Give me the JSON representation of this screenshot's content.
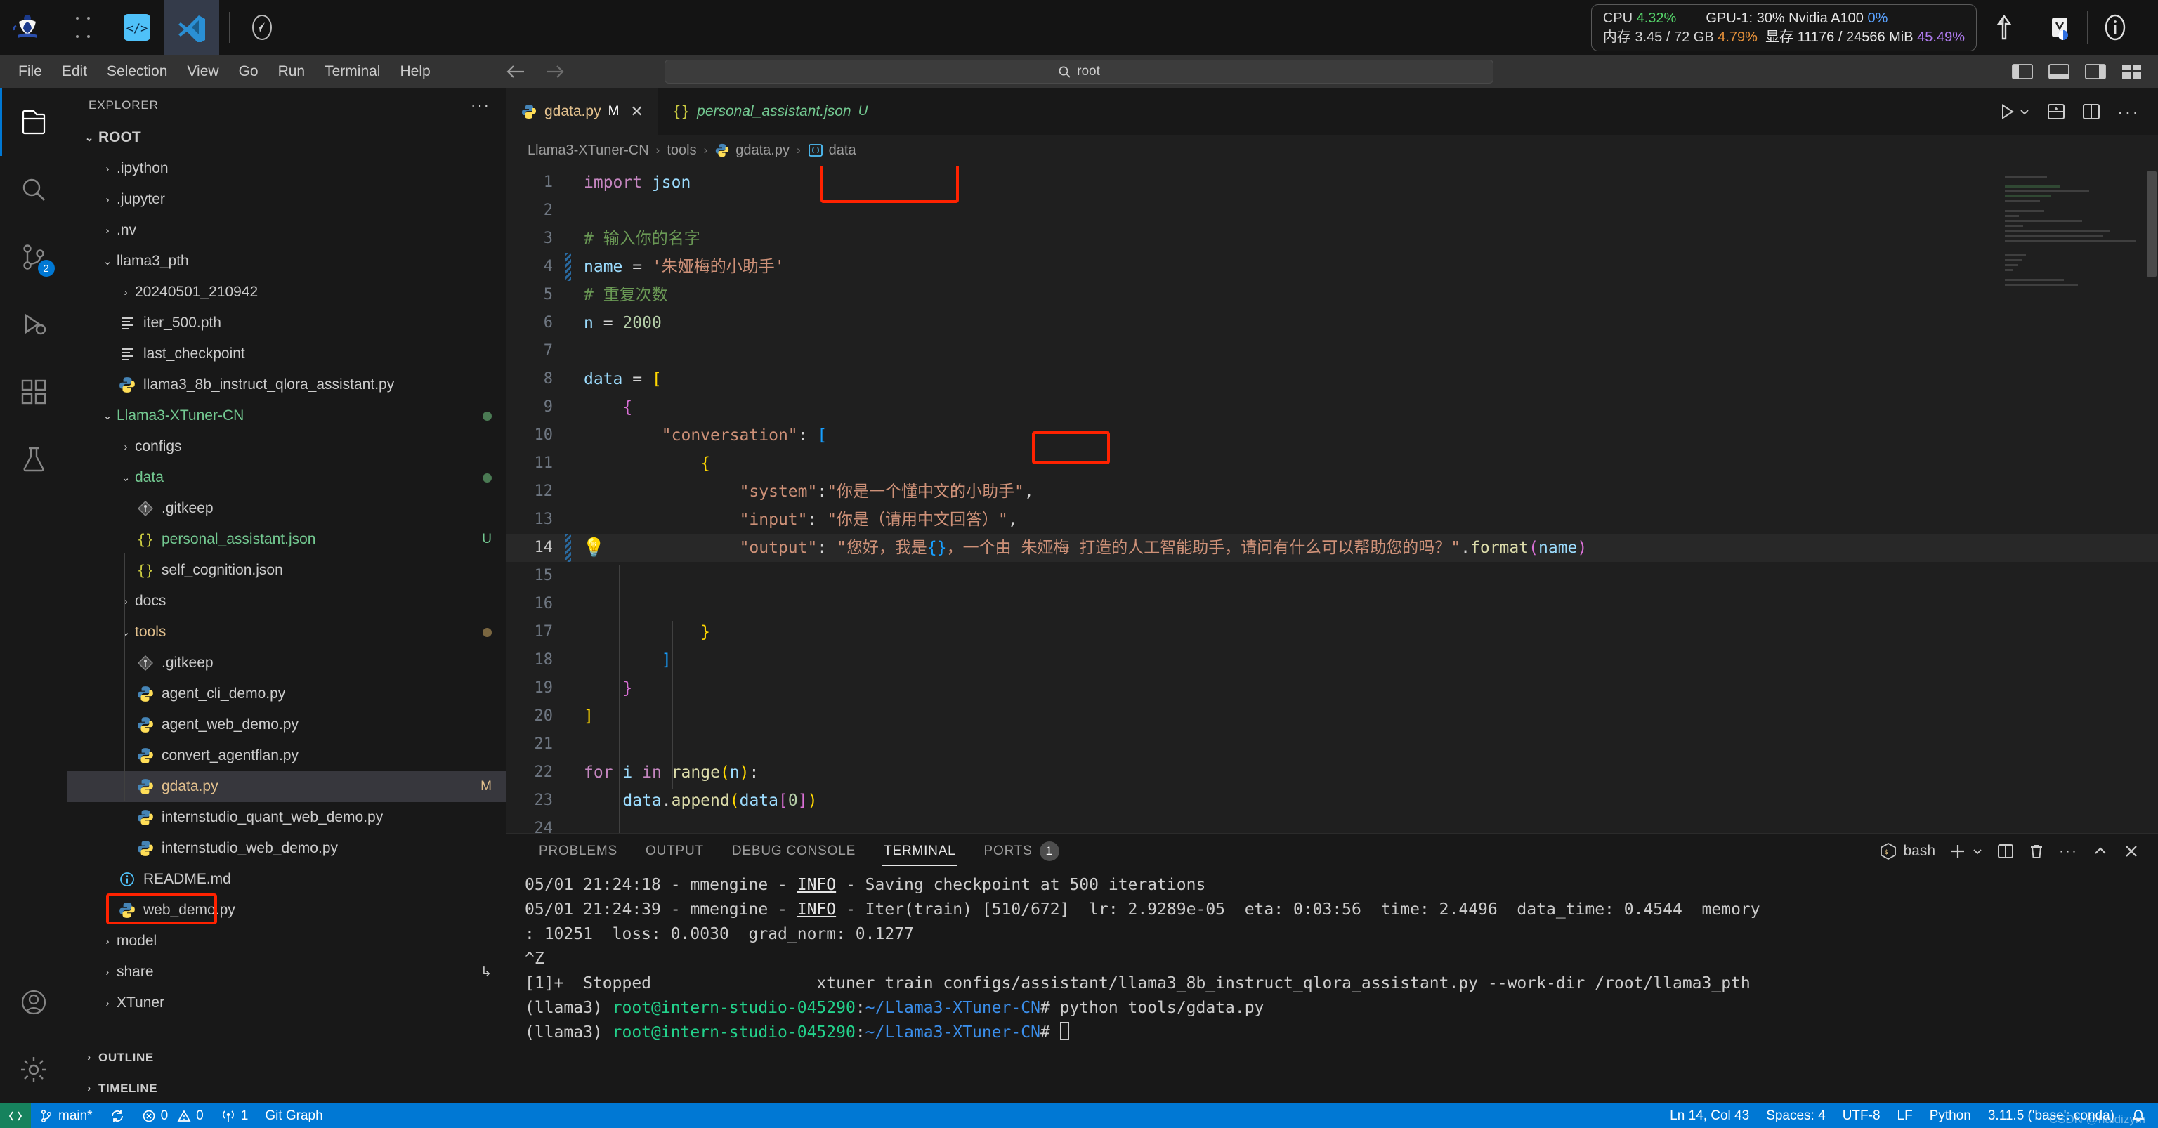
{
  "os_bar": {
    "apps": [
      {
        "name": "jupyter-logo",
        "label": "Jupyter"
      },
      {
        "name": "conda-logo",
        "label": "Anaconda"
      },
      {
        "name": "code-server-logo",
        "label": "Code Server"
      },
      {
        "name": "vscode-logo",
        "label": "Visual Studio Code"
      }
    ],
    "compass_label": "Compass",
    "stats": {
      "cpu_label": "CPU",
      "cpu_value": "4.32%",
      "gpu_label": "GPU-1: 30% Nvidia A100",
      "gpu_value": "0%",
      "mem_label": "内存 3.45 / 72 GB",
      "mem_value": "4.79%",
      "vram_label": "显存 11176 / 24566 MiB",
      "vram_value": "45.49%"
    },
    "right_icons": [
      "upload-icon",
      "extension-icon",
      "info-icon"
    ]
  },
  "menubar": {
    "items": [
      "File",
      "Edit",
      "Selection",
      "View",
      "Go",
      "Run",
      "Terminal",
      "Help"
    ],
    "back_label": "Go Back",
    "forward_label": "Go Forward",
    "search_placeholder": "root",
    "search_icon": "search-icon",
    "layout_icons": [
      "toggle-primary-sidebar-icon",
      "toggle-panel-icon",
      "toggle-secondary-sidebar-icon",
      "customize-layout-icon"
    ]
  },
  "activitybar": {
    "items": [
      {
        "name": "explorer",
        "icon": "files-icon",
        "badge": ""
      },
      {
        "name": "search",
        "icon": "search-icon",
        "badge": ""
      },
      {
        "name": "source-control",
        "icon": "source-control-icon",
        "badge": "2"
      },
      {
        "name": "run-debug",
        "icon": "run-debug-icon",
        "badge": ""
      },
      {
        "name": "extensions",
        "icon": "extensions-icon",
        "badge": ""
      },
      {
        "name": "testing",
        "icon": "beaker-icon",
        "badge": ""
      }
    ],
    "bottom": [
      {
        "name": "accounts",
        "icon": "account-icon"
      },
      {
        "name": "settings",
        "icon": "gear-icon"
      }
    ]
  },
  "explorer": {
    "title": "EXPLORER",
    "more_actions": "···",
    "root_label": "ROOT",
    "tree": [
      {
        "label": ".ipython",
        "indent": 1,
        "type": "folder",
        "state": "collapsed",
        "icon": "folder-icon"
      },
      {
        "label": ".jupyter",
        "indent": 1,
        "type": "folder",
        "state": "collapsed",
        "icon": "folder-icon"
      },
      {
        "label": ".nv",
        "indent": 1,
        "type": "folder",
        "state": "collapsed",
        "icon": "folder-icon"
      },
      {
        "label": "llama3_pth",
        "indent": 1,
        "type": "folder",
        "state": "expanded",
        "icon": "folder-icon"
      },
      {
        "label": "20240501_210942",
        "indent": 2,
        "type": "folder",
        "state": "collapsed",
        "icon": "folder-icon"
      },
      {
        "label": "iter_500.pth",
        "indent": 2,
        "type": "file",
        "icon": "file-lines-icon"
      },
      {
        "label": "last_checkpoint",
        "indent": 2,
        "type": "file",
        "icon": "file-lines-icon"
      },
      {
        "label": "llama3_8b_instruct_qlora_assistant.py",
        "indent": 2,
        "type": "file",
        "icon": "python-icon"
      },
      {
        "label": "Llama3-XTuner-CN",
        "indent": 1,
        "type": "folder",
        "state": "expanded",
        "icon": "folder-icon",
        "color": "green",
        "dot": "#4a7a53"
      },
      {
        "label": "configs",
        "indent": 2,
        "type": "folder",
        "state": "collapsed",
        "icon": "folder-icon"
      },
      {
        "label": "data",
        "indent": 2,
        "type": "folder",
        "state": "expanded",
        "icon": "folder-icon",
        "color": "green",
        "dot": "#4a7a53"
      },
      {
        "label": ".gitkeep",
        "indent": 3,
        "type": "file",
        "icon": "git-icon"
      },
      {
        "label": "personal_assistant.json",
        "indent": 3,
        "type": "file",
        "icon": "json-icon",
        "color": "green",
        "badge": "U",
        "badge_color": "green"
      },
      {
        "label": "self_cognition.json",
        "indent": 3,
        "type": "file",
        "icon": "json-icon"
      },
      {
        "label": "docs",
        "indent": 2,
        "type": "folder",
        "state": "collapsed",
        "icon": "folder-icon"
      },
      {
        "label": "tools",
        "indent": 2,
        "type": "folder",
        "state": "expanded",
        "icon": "folder-icon",
        "color": "orange",
        "dot": "#7a6640"
      },
      {
        "label": ".gitkeep",
        "indent": 3,
        "type": "file",
        "icon": "git-icon"
      },
      {
        "label": "agent_cli_demo.py",
        "indent": 3,
        "type": "file",
        "icon": "python-icon"
      },
      {
        "label": "agent_web_demo.py",
        "indent": 3,
        "type": "file",
        "icon": "python-icon"
      },
      {
        "label": "convert_agentflan.py",
        "indent": 3,
        "type": "file",
        "icon": "python-icon"
      },
      {
        "label": "gdata.py",
        "indent": 3,
        "type": "file",
        "icon": "python-icon",
        "color": "orange",
        "badge": "M",
        "badge_color": "orange",
        "selected": true,
        "highlight": true
      },
      {
        "label": "internstudio_quant_web_demo.py",
        "indent": 3,
        "type": "file",
        "icon": "python-icon"
      },
      {
        "label": "internstudio_web_demo.py",
        "indent": 3,
        "type": "file",
        "icon": "python-icon"
      },
      {
        "label": "README.md",
        "indent": 2,
        "type": "file",
        "icon": "info-md-icon"
      },
      {
        "label": "web_demo.py",
        "indent": 2,
        "type": "file",
        "icon": "python-icon"
      },
      {
        "label": "model",
        "indent": 1,
        "type": "folder",
        "state": "collapsed",
        "icon": "folder-icon"
      },
      {
        "label": "share",
        "indent": 1,
        "type": "folder",
        "state": "collapsed",
        "icon": "folder-icon",
        "badge": "↳"
      },
      {
        "label": "XTuner",
        "indent": 1,
        "type": "folder",
        "state": "collapsed",
        "icon": "folder-icon"
      }
    ],
    "sections": [
      "OUTLINE",
      "TIMELINE"
    ]
  },
  "editor": {
    "tabs": [
      {
        "label": "gdata.py",
        "icon": "python-icon",
        "modified": "M",
        "active": true,
        "close": "✕"
      },
      {
        "label": "personal_assistant.json",
        "icon": "json-icon",
        "modified": "U",
        "active": false
      }
    ],
    "actions": [
      "run-python-file-icon",
      "run-dropdown-icon",
      "split-editor-right-icon",
      "more-actions-icon"
    ],
    "breadcrumb": [
      "Llama3-XTuner-CN",
      "tools",
      "gdata.py",
      "data"
    ],
    "breadcrumb_icons": [
      "",
      "",
      "python-icon",
      "variable-icon"
    ],
    "lines": [
      {
        "n": 1,
        "tokens": [
          [
            "kw",
            "import"
          ],
          [
            "plain",
            " "
          ],
          [
            "var",
            "json"
          ]
        ]
      },
      {
        "n": 2,
        "tokens": []
      },
      {
        "n": 3,
        "tokens": [
          [
            "cmt",
            "# 输入你的名字"
          ]
        ]
      },
      {
        "n": 4,
        "tokens": [
          [
            "var",
            "name"
          ],
          [
            "op",
            " = "
          ],
          [
            "str",
            "'朱娅梅的小助手'"
          ]
        ],
        "diff": true,
        "cursorline": false
      },
      {
        "n": 5,
        "tokens": [
          [
            "cmt",
            "# 重复次数"
          ]
        ]
      },
      {
        "n": 6,
        "tokens": [
          [
            "var",
            "n"
          ],
          [
            "op",
            " = "
          ],
          [
            "num",
            "2000"
          ]
        ]
      },
      {
        "n": 7,
        "tokens": []
      },
      {
        "n": 8,
        "tokens": [
          [
            "var",
            "data"
          ],
          [
            "op",
            " = "
          ],
          [
            "br-y",
            "["
          ]
        ]
      },
      {
        "n": 9,
        "tokens": [
          [
            "plain",
            "    "
          ],
          [
            "br-p",
            "{"
          ]
        ]
      },
      {
        "n": 10,
        "tokens": [
          [
            "plain",
            "        "
          ],
          [
            "key",
            "\"conversation\""
          ],
          [
            "op",
            ": "
          ],
          [
            "br-b",
            "["
          ]
        ]
      },
      {
        "n": 11,
        "tokens": [
          [
            "plain",
            "            "
          ],
          [
            "br-y",
            "{"
          ]
        ]
      },
      {
        "n": 12,
        "tokens": [
          [
            "plain",
            "                "
          ],
          [
            "key",
            "\"system\""
          ],
          [
            "op",
            ":"
          ],
          [
            "str",
            "\"你是一个懂中文的小助手\""
          ],
          [
            "op",
            ","
          ]
        ]
      },
      {
        "n": 13,
        "tokens": [
          [
            "plain",
            "                "
          ],
          [
            "key",
            "\"input\""
          ],
          [
            "op",
            ": "
          ],
          [
            "str",
            "\"你是（请用中文回答）\""
          ],
          [
            "op",
            ","
          ]
        ]
      },
      {
        "n": 14,
        "tokens": [
          [
            "plain",
            "                "
          ],
          [
            "key",
            "\"output\""
          ],
          [
            "op",
            ": "
          ],
          [
            "str",
            "\"您好，我是"
          ],
          [
            "br-b",
            "{}"
          ],
          [
            "str",
            "，一个由 朱娅梅 打造的人工智能助手，请问有什么可以帮助您的吗？\""
          ],
          [
            "op",
            "."
          ],
          [
            "fn",
            "format"
          ],
          [
            "br-p",
            "("
          ],
          [
            "var",
            "name"
          ],
          [
            "br-p",
            ")"
          ]
        ],
        "diff": true,
        "cursorline": true,
        "bulb": true
      },
      {
        "n": 15,
        "tokens": []
      },
      {
        "n": 16,
        "tokens": []
      },
      {
        "n": 17,
        "tokens": [
          [
            "plain",
            "            "
          ],
          [
            "br-y",
            "}"
          ]
        ]
      },
      {
        "n": 18,
        "tokens": [
          [
            "plain",
            "        "
          ],
          [
            "br-b",
            "]"
          ]
        ]
      },
      {
        "n": 19,
        "tokens": [
          [
            "plain",
            "    "
          ],
          [
            "br-p",
            "}"
          ]
        ]
      },
      {
        "n": 20,
        "tokens": [
          [
            "br-y",
            "]"
          ]
        ]
      },
      {
        "n": 21,
        "tokens": []
      },
      {
        "n": 22,
        "tokens": [
          [
            "kw",
            "for"
          ],
          [
            "plain",
            " "
          ],
          [
            "var",
            "i"
          ],
          [
            "plain",
            " "
          ],
          [
            "kw",
            "in"
          ],
          [
            "plain",
            " "
          ],
          [
            "fn",
            "range"
          ],
          [
            "br-y",
            "("
          ],
          [
            "var",
            "n"
          ],
          [
            "br-y",
            ")"
          ],
          [
            "op",
            ":"
          ]
        ]
      },
      {
        "n": 23,
        "tokens": [
          [
            "plain",
            "    "
          ],
          [
            "var",
            "data"
          ],
          [
            "op",
            "."
          ],
          [
            "fn",
            "append"
          ],
          [
            "br-y",
            "("
          ],
          [
            "var",
            "data"
          ],
          [
            "br-p",
            "["
          ],
          [
            "num",
            "0"
          ],
          [
            "br-p",
            "]"
          ],
          [
            "br-y",
            ")"
          ]
        ]
      },
      {
        "n": 24,
        "tokens": []
      }
    ],
    "highlights": [
      {
        "name": "name-variable-highlight"
      },
      {
        "name": "output-name-highlight"
      }
    ]
  },
  "panel": {
    "tabs": [
      {
        "label": "PROBLEMS",
        "active": false
      },
      {
        "label": "OUTPUT",
        "active": false
      },
      {
        "label": "DEBUG CONSOLE",
        "active": false
      },
      {
        "label": "TERMINAL",
        "active": true
      },
      {
        "label": "PORTS",
        "active": false,
        "badge": "1"
      }
    ],
    "shell_name": "bash",
    "actions": [
      "new-terminal-icon",
      "terminal-dropdown-icon",
      "split-terminal-icon",
      "kill-terminal-icon",
      "more-actions-icon",
      "maximize-panel-icon",
      "close-panel-icon"
    ],
    "terminal_lines": [
      {
        "segments": [
          [
            "plain",
            "05/01 21:24:18 - mmengine - "
          ],
          [
            "info",
            "INFO"
          ],
          [
            "plain",
            " - Saving checkpoint at 500 iterations"
          ]
        ]
      },
      {
        "segments": [
          [
            "plain",
            "05/01 21:24:39 - mmengine - "
          ],
          [
            "info",
            "INFO"
          ],
          [
            "plain",
            " - Iter(train) [510/672]  lr: 2.9289e-05  eta: 0:03:56  time: 2.4496  data_time: 0.4544  memory"
          ]
        ]
      },
      {
        "segments": [
          [
            "plain",
            ": 10251  loss: 0.0030  grad_norm: 0.1277"
          ]
        ]
      },
      {
        "segments": [
          [
            "plain",
            "^Z"
          ]
        ]
      },
      {
        "segments": [
          [
            "plain",
            "[1]+  Stopped                 xtuner train configs/assistant/llama3_8b_instruct_qlora_assistant.py --work-dir /root/llama3_pth"
          ]
        ]
      },
      {
        "segments": [
          [
            "plain",
            "(llama3) "
          ],
          [
            "green",
            "root@intern-studio-045290"
          ],
          [
            "plain",
            ":"
          ],
          [
            "blue",
            "~/Llama3-XTuner-CN"
          ],
          [
            "plain",
            "# python tools/gdata.py"
          ]
        ]
      },
      {
        "segments": [
          [
            "plain",
            "(llama3) "
          ],
          [
            "green",
            "root@intern-studio-045290"
          ],
          [
            "plain",
            ":"
          ],
          [
            "blue",
            "~/Llama3-XTuner-CN"
          ],
          [
            "plain",
            "# "
          ],
          [
            "cursor",
            ""
          ]
        ]
      }
    ]
  },
  "statusbar": {
    "left": [
      {
        "name": "remote-indicator",
        "icon": "remote-icon",
        "label": ""
      },
      {
        "name": "git-branch",
        "icon": "branch-icon",
        "label": "main*"
      },
      {
        "name": "sync-changes",
        "icon": "sync-icon",
        "label": ""
      },
      {
        "name": "errors-warnings",
        "icon": "error-warning-icon",
        "label": "0  0"
      },
      {
        "name": "ports-forwarded",
        "icon": "radio-tower-icon",
        "label": "1"
      },
      {
        "name": "git-graph",
        "icon": "",
        "label": "Git Graph"
      }
    ],
    "right": [
      {
        "name": "editor-position",
        "label": "Ln 14, Col 43"
      },
      {
        "name": "indentation",
        "label": "Spaces: 4"
      },
      {
        "name": "encoding",
        "label": "UTF-8"
      },
      {
        "name": "eol",
        "label": "LF"
      },
      {
        "name": "language-mode",
        "label": "Python"
      },
      {
        "name": "python-interpreter",
        "label": "3.11.5 ('base': conda)"
      },
      {
        "name": "notifications",
        "label": "",
        "icon": "bell-icon"
      }
    ],
    "watermark": "CSDN @haidizym"
  }
}
